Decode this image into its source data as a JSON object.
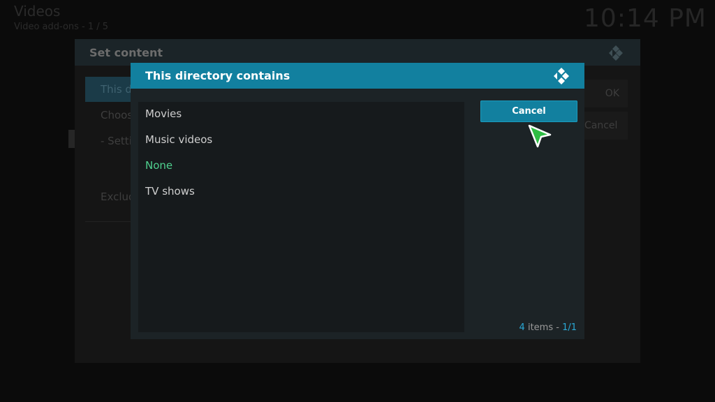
{
  "background": {
    "title": "Videos",
    "subtitle": "Video add-ons - 1 / 5",
    "clock": "10:14 PM"
  },
  "set_content_dialog": {
    "title": "Set content",
    "items": [
      {
        "label": "This directory contains"
      },
      {
        "label": "Choose information provider"
      },
      {
        "label": "- Settings"
      }
    ],
    "exclude_label": "Exclude path from library updates",
    "ok_label": "OK",
    "cancel_label": "Cancel"
  },
  "directory_dialog": {
    "title": "This directory contains",
    "options": [
      {
        "label": "Movies",
        "selected": false
      },
      {
        "label": "Music videos",
        "selected": false
      },
      {
        "label": "None",
        "selected": true
      },
      {
        "label": "TV shows",
        "selected": false
      }
    ],
    "cancel_label": "Cancel",
    "count_number": "4",
    "count_text": "items -",
    "count_page": "1/1"
  },
  "colors": {
    "accent": "#12809f",
    "selected_text": "#4fd18f",
    "highlight_text": "#2aa9d6",
    "pointer": "#2fbd44"
  },
  "icons": {
    "app_logo": "kodi-logo-icon",
    "mouse_pointer": "mouse-pointer-icon"
  }
}
